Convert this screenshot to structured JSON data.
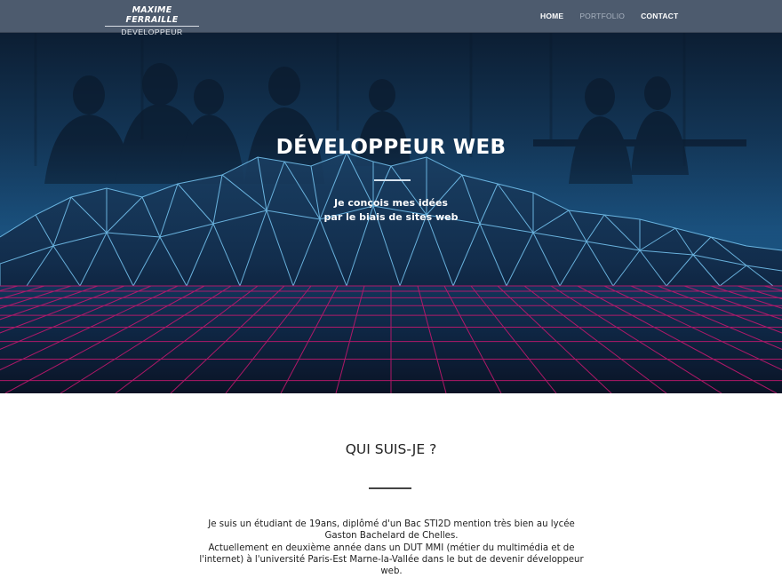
{
  "nav": {
    "brand_name": "Maxime Ferraille",
    "brand_sub": "DEVELOPPEUR",
    "links": [
      "HOME",
      "PORTFOLIO",
      "CONTACT"
    ]
  },
  "hero": {
    "title": "DÉVELOPPEUR WEB",
    "subtitle_line1": "Je conçois mes idées",
    "subtitle_line2": "par le biais de sites web"
  },
  "about": {
    "title": "QUI SUIS-JE ?",
    "paragraph1": "Je suis un étudiant de 19ans, diplômé d'un Bac STI2D mention très bien au lycée Gaston Bachelard de Chelles.",
    "paragraph2": "Actuellement en deuxième année dans un DUT MMI (métier du multimédia et de l'internet) à l'université Paris-Est Marne-la-Vallée dans le but de devenir développeur web."
  },
  "colors": {
    "navbar": "#4d5b6e",
    "grid": "#c0186e",
    "mesh": "#78c8f5"
  }
}
